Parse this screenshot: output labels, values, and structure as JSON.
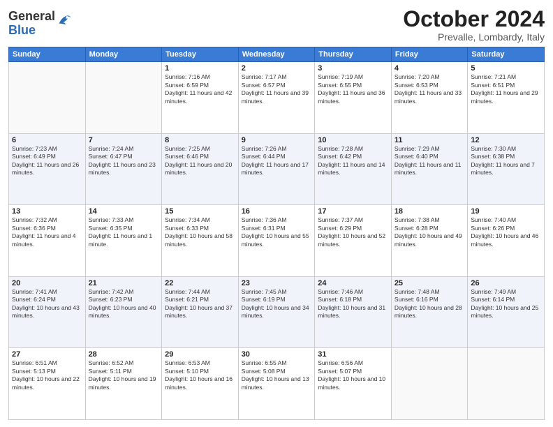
{
  "header": {
    "logo_general": "General",
    "logo_blue": "Blue",
    "month": "October 2024",
    "location": "Prevalle, Lombardy, Italy"
  },
  "weekdays": [
    "Sunday",
    "Monday",
    "Tuesday",
    "Wednesday",
    "Thursday",
    "Friday",
    "Saturday"
  ],
  "weeks": [
    [
      {
        "day": "",
        "info": ""
      },
      {
        "day": "",
        "info": ""
      },
      {
        "day": "1",
        "info": "Sunrise: 7:16 AM\nSunset: 6:59 PM\nDaylight: 11 hours and 42 minutes."
      },
      {
        "day": "2",
        "info": "Sunrise: 7:17 AM\nSunset: 6:57 PM\nDaylight: 11 hours and 39 minutes."
      },
      {
        "day": "3",
        "info": "Sunrise: 7:19 AM\nSunset: 6:55 PM\nDaylight: 11 hours and 36 minutes."
      },
      {
        "day": "4",
        "info": "Sunrise: 7:20 AM\nSunset: 6:53 PM\nDaylight: 11 hours and 33 minutes."
      },
      {
        "day": "5",
        "info": "Sunrise: 7:21 AM\nSunset: 6:51 PM\nDaylight: 11 hours and 29 minutes."
      }
    ],
    [
      {
        "day": "6",
        "info": "Sunrise: 7:23 AM\nSunset: 6:49 PM\nDaylight: 11 hours and 26 minutes."
      },
      {
        "day": "7",
        "info": "Sunrise: 7:24 AM\nSunset: 6:47 PM\nDaylight: 11 hours and 23 minutes."
      },
      {
        "day": "8",
        "info": "Sunrise: 7:25 AM\nSunset: 6:46 PM\nDaylight: 11 hours and 20 minutes."
      },
      {
        "day": "9",
        "info": "Sunrise: 7:26 AM\nSunset: 6:44 PM\nDaylight: 11 hours and 17 minutes."
      },
      {
        "day": "10",
        "info": "Sunrise: 7:28 AM\nSunset: 6:42 PM\nDaylight: 11 hours and 14 minutes."
      },
      {
        "day": "11",
        "info": "Sunrise: 7:29 AM\nSunset: 6:40 PM\nDaylight: 11 hours and 11 minutes."
      },
      {
        "day": "12",
        "info": "Sunrise: 7:30 AM\nSunset: 6:38 PM\nDaylight: 11 hours and 7 minutes."
      }
    ],
    [
      {
        "day": "13",
        "info": "Sunrise: 7:32 AM\nSunset: 6:36 PM\nDaylight: 11 hours and 4 minutes."
      },
      {
        "day": "14",
        "info": "Sunrise: 7:33 AM\nSunset: 6:35 PM\nDaylight: 11 hours and 1 minute."
      },
      {
        "day": "15",
        "info": "Sunrise: 7:34 AM\nSunset: 6:33 PM\nDaylight: 10 hours and 58 minutes."
      },
      {
        "day": "16",
        "info": "Sunrise: 7:36 AM\nSunset: 6:31 PM\nDaylight: 10 hours and 55 minutes."
      },
      {
        "day": "17",
        "info": "Sunrise: 7:37 AM\nSunset: 6:29 PM\nDaylight: 10 hours and 52 minutes."
      },
      {
        "day": "18",
        "info": "Sunrise: 7:38 AM\nSunset: 6:28 PM\nDaylight: 10 hours and 49 minutes."
      },
      {
        "day": "19",
        "info": "Sunrise: 7:40 AM\nSunset: 6:26 PM\nDaylight: 10 hours and 46 minutes."
      }
    ],
    [
      {
        "day": "20",
        "info": "Sunrise: 7:41 AM\nSunset: 6:24 PM\nDaylight: 10 hours and 43 minutes."
      },
      {
        "day": "21",
        "info": "Sunrise: 7:42 AM\nSunset: 6:23 PM\nDaylight: 10 hours and 40 minutes."
      },
      {
        "day": "22",
        "info": "Sunrise: 7:44 AM\nSunset: 6:21 PM\nDaylight: 10 hours and 37 minutes."
      },
      {
        "day": "23",
        "info": "Sunrise: 7:45 AM\nSunset: 6:19 PM\nDaylight: 10 hours and 34 minutes."
      },
      {
        "day": "24",
        "info": "Sunrise: 7:46 AM\nSunset: 6:18 PM\nDaylight: 10 hours and 31 minutes."
      },
      {
        "day": "25",
        "info": "Sunrise: 7:48 AM\nSunset: 6:16 PM\nDaylight: 10 hours and 28 minutes."
      },
      {
        "day": "26",
        "info": "Sunrise: 7:49 AM\nSunset: 6:14 PM\nDaylight: 10 hours and 25 minutes."
      }
    ],
    [
      {
        "day": "27",
        "info": "Sunrise: 6:51 AM\nSunset: 5:13 PM\nDaylight: 10 hours and 22 minutes."
      },
      {
        "day": "28",
        "info": "Sunrise: 6:52 AM\nSunset: 5:11 PM\nDaylight: 10 hours and 19 minutes."
      },
      {
        "day": "29",
        "info": "Sunrise: 6:53 AM\nSunset: 5:10 PM\nDaylight: 10 hours and 16 minutes."
      },
      {
        "day": "30",
        "info": "Sunrise: 6:55 AM\nSunset: 5:08 PM\nDaylight: 10 hours and 13 minutes."
      },
      {
        "day": "31",
        "info": "Sunrise: 6:56 AM\nSunset: 5:07 PM\nDaylight: 10 hours and 10 minutes."
      },
      {
        "day": "",
        "info": ""
      },
      {
        "day": "",
        "info": ""
      }
    ]
  ]
}
